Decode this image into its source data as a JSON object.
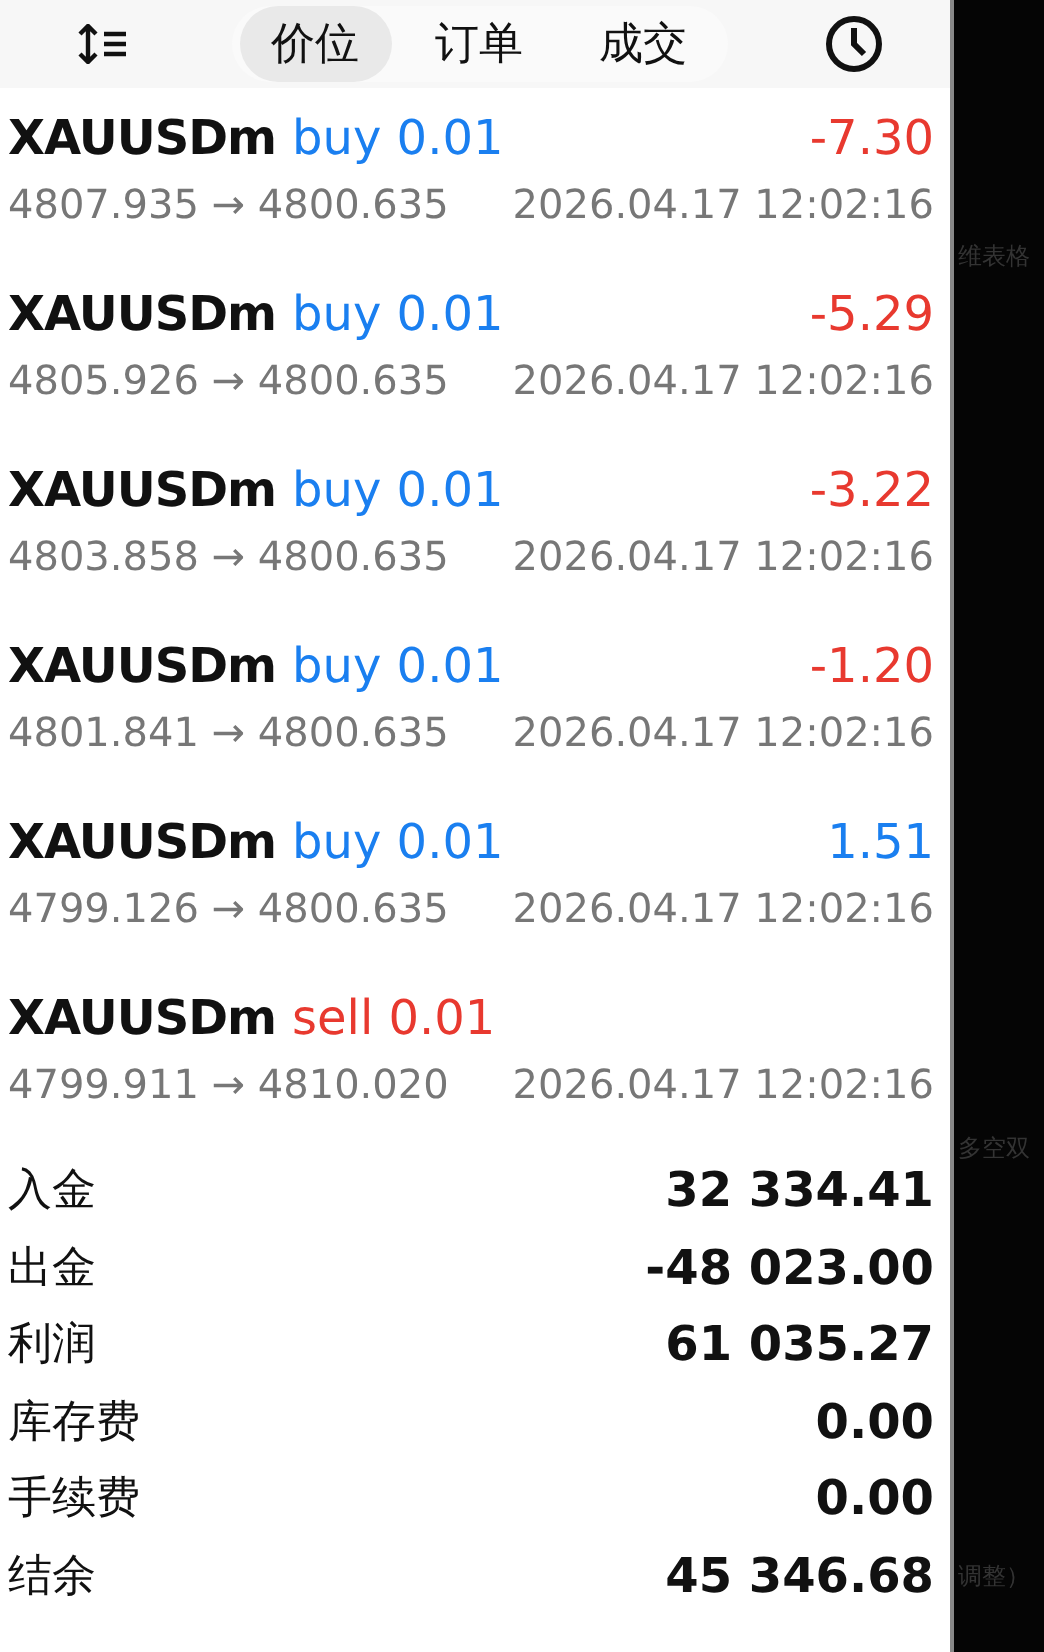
{
  "toolbar": {
    "tabs": [
      {
        "label": "价位",
        "selected": true
      },
      {
        "label": "订单",
        "selected": false
      },
      {
        "label": "成交",
        "selected": false
      }
    ]
  },
  "deals": [
    {
      "symbol": "XAUUSDm",
      "side": "buy",
      "volume": "0.01",
      "profit": "-7.30",
      "open_price": "4807.935",
      "arrow": "→",
      "close_price": "4800.635",
      "time": "2026.04.17 12:02:16"
    },
    {
      "symbol": "XAUUSDm",
      "side": "buy",
      "volume": "0.01",
      "profit": "-5.29",
      "open_price": "4805.926",
      "arrow": "→",
      "close_price": "4800.635",
      "time": "2026.04.17 12:02:16"
    },
    {
      "symbol": "XAUUSDm",
      "side": "buy",
      "volume": "0.01",
      "profit": "-3.22",
      "open_price": "4803.858",
      "arrow": "→",
      "close_price": "4800.635",
      "time": "2026.04.17 12:02:16"
    },
    {
      "symbol": "XAUUSDm",
      "side": "buy",
      "volume": "0.01",
      "profit": "-1.20",
      "open_price": "4801.841",
      "arrow": "→",
      "close_price": "4800.635",
      "time": "2026.04.17 12:02:16"
    },
    {
      "symbol": "XAUUSDm",
      "side": "buy",
      "volume": "0.01",
      "profit": "1.51",
      "open_price": "4799.126",
      "arrow": "→",
      "close_price": "4800.635",
      "time": "2026.04.17 12:02:16"
    },
    {
      "symbol": "XAUUSDm",
      "side": "sell",
      "volume": "0.01",
      "open_price": "4799.911",
      "arrow": "→",
      "close_price": "4810.020",
      "time": "2026.04.17 12:02:16"
    }
  ],
  "summary": [
    {
      "label": "入金",
      "value": "32 334.41"
    },
    {
      "label": "出金",
      "value": "-48 023.00"
    },
    {
      "label": "利润",
      "value": "61 035.27"
    },
    {
      "label": "库存费",
      "value": "0.00"
    },
    {
      "label": "手续费",
      "value": "0.00"
    },
    {
      "label": "结余",
      "value": "45 346.68"
    }
  ],
  "background_panel": {
    "texts": [
      "维表格",
      "多空双",
      "调整）"
    ]
  }
}
